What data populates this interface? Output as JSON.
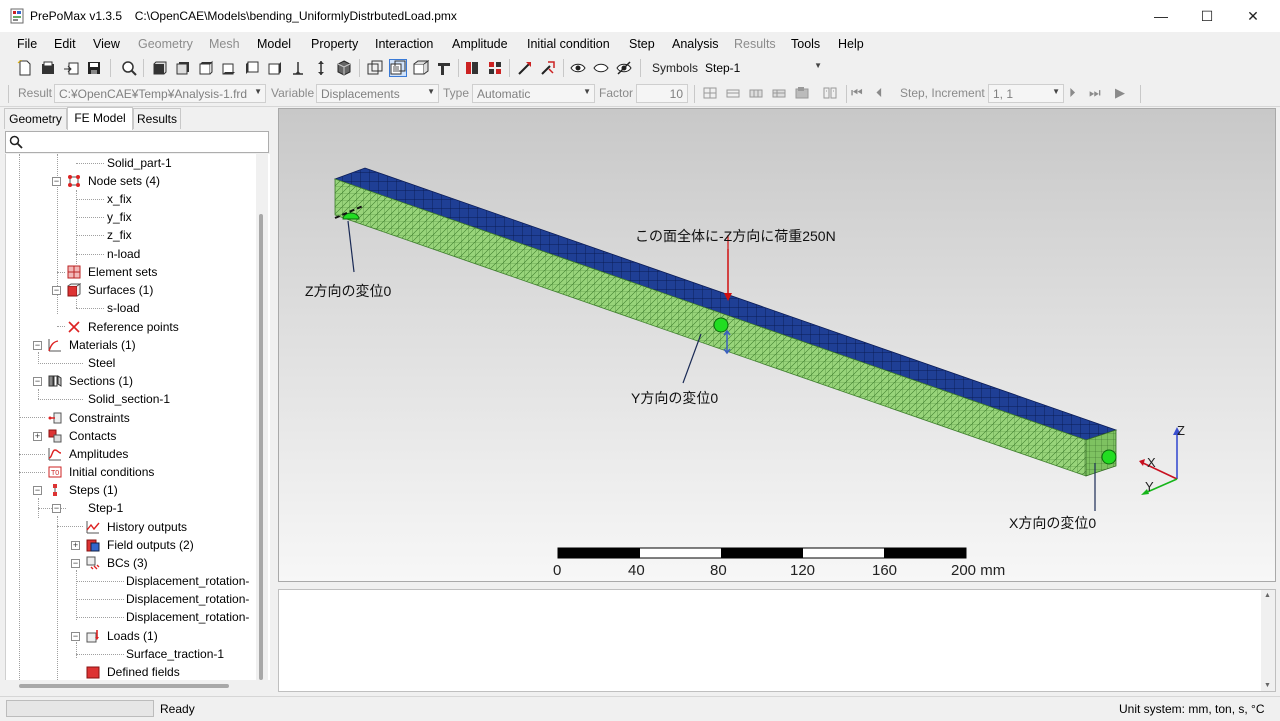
{
  "window": {
    "app_name": "PrePoMax v1.3.5",
    "file_path": "C:\\OpenCAE\\Models\\bending_UniformlyDistrbutedLoad.pmx",
    "min_glyph": "—",
    "max_glyph": "☐",
    "close_glyph": "✕"
  },
  "menu": {
    "items": [
      "File",
      "Edit",
      "View",
      "Geometry",
      "Mesh",
      "Model",
      "Property",
      "Interaction",
      "Amplitude",
      "Initial condition",
      "Step",
      "Analysis",
      "Results",
      "Tools",
      "Help"
    ]
  },
  "toolbar1": {
    "symbols_label": "Symbols",
    "step_value": "Step-1"
  },
  "toolbar2": {
    "result_label": "Result",
    "result_value": "C:¥OpenCAE¥Temp¥Analysis-1.frd",
    "variable_label": "Variable",
    "variable_value": "Displacements",
    "type_label": "Type",
    "type_value": "Automatic",
    "factor_label": "Factor",
    "factor_value": "10",
    "step_increment_label": "Step, Increment",
    "step_increment_value": "1, 1"
  },
  "tabs": [
    "Geometry",
    "FE Model",
    "Results"
  ],
  "search": {
    "placeholder": ""
  },
  "tree": {
    "solid_part": "Solid_part-1",
    "node_sets": "Node sets (4)",
    "x_fix": "x_fix",
    "y_fix": "y_fix",
    "z_fix": "z_fix",
    "n_load": "n-load",
    "element_sets": "Element sets",
    "surfaces": "Surfaces (1)",
    "s_load": "s-load",
    "reference_points": "Reference points",
    "materials": "Materials (1)",
    "steel": "Steel",
    "sections": "Sections (1)",
    "solid_section": "Solid_section-1",
    "constraints": "Constraints",
    "contacts": "Contacts",
    "amplitudes": "Amplitudes",
    "initial_conditions": "Initial conditions",
    "steps": "Steps (1)",
    "step1": "Step-1",
    "history_outputs": "History outputs",
    "field_outputs": "Field outputs (2)",
    "bcs": "BCs (3)",
    "bc1": "Displacement_rotation-",
    "bc2": "Displacement_rotation-",
    "bc3": "Displacement_rotation-",
    "loads": "Loads (1)",
    "surface_traction": "Surface_traction-1",
    "defined_fields": "Defined fields"
  },
  "viewport": {
    "annotation_load": "この面全体に-Z方向に荷重250N",
    "annotation_z": "Z方向の変位0",
    "annotation_y": "Y方向の変位0",
    "annotation_x": "X方向の変位0",
    "axis_x": "X",
    "axis_y": "Y",
    "axis_z": "Z",
    "scale_ticks": [
      "0",
      "40",
      "80",
      "120",
      "160",
      "200 mm"
    ],
    "colors": {
      "top_face": "#1e3a8a",
      "side_face": "#8fcf6e",
      "load_arrow": "#d01010",
      "bc_marker": "#22dd22"
    }
  },
  "status": {
    "message": "Ready",
    "unit_system": "Unit system: mm, ton, s, °C"
  }
}
